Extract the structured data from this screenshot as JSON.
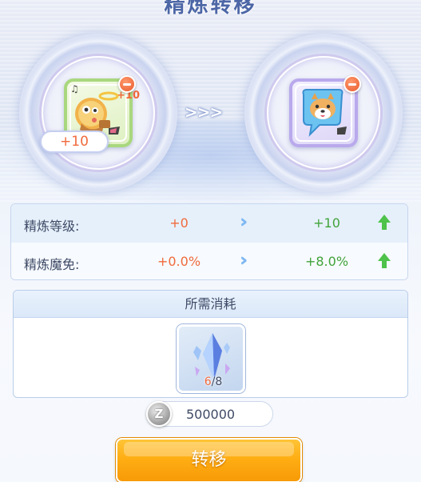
{
  "title": "精炼转移",
  "source_item": {
    "icon": "cat-angel-headwear-icon",
    "card_level": "+10",
    "level_badge": "+10"
  },
  "target_item": {
    "icon": "shiba-speech-bubble-headwear-icon"
  },
  "arrows": ">>>",
  "stats": [
    {
      "label": "精炼等级:",
      "from": "+0",
      "to": "+10"
    },
    {
      "label": "精炼魔免:",
      "from": "+0.0%",
      "to": "+8.0%"
    }
  ],
  "cost": {
    "header": "所需消耗",
    "material_icon": "blue-crystal-icon",
    "have": "6",
    "need": "/8"
  },
  "currency": {
    "icon": "zeny-coin-icon",
    "amount": "500000"
  },
  "action_button": "转移",
  "colors": {
    "orange": "#f06a3c",
    "green": "#41a33a",
    "button": "#ffae14"
  }
}
